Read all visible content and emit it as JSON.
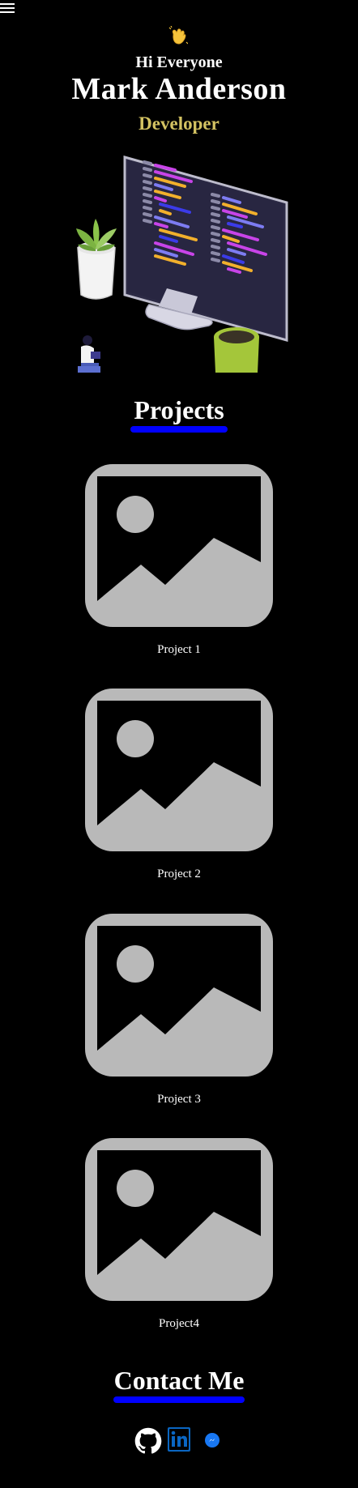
{
  "header": {
    "menu_icon": "hamburger-menu-icon"
  },
  "hero": {
    "wave_icon": "waving-hand-icon",
    "greeting": "Hi Everyone",
    "name": "Mark Anderson",
    "role": "Developer"
  },
  "projects": {
    "title": "Projects",
    "items": [
      {
        "label": "Project 1",
        "icon": "image-placeholder-icon"
      },
      {
        "label": "Project 2",
        "icon": "image-placeholder-icon"
      },
      {
        "label": "Project 3",
        "icon": "image-placeholder-icon"
      },
      {
        "label": "Project4",
        "icon": "image-placeholder-icon"
      }
    ]
  },
  "contact": {
    "title": "Contact Me",
    "links": [
      {
        "icon": "github-icon"
      },
      {
        "icon": "linkedin-icon"
      },
      {
        "icon": "chat-bubble-icon"
      }
    ]
  },
  "colors": {
    "background": "#000000",
    "text": "#ffffff",
    "role": "#d3c262",
    "underline": "#0000ff",
    "placeholder": "#b9b9b9",
    "linkedin": "#0a66c2",
    "messenger": "#1877f2"
  }
}
